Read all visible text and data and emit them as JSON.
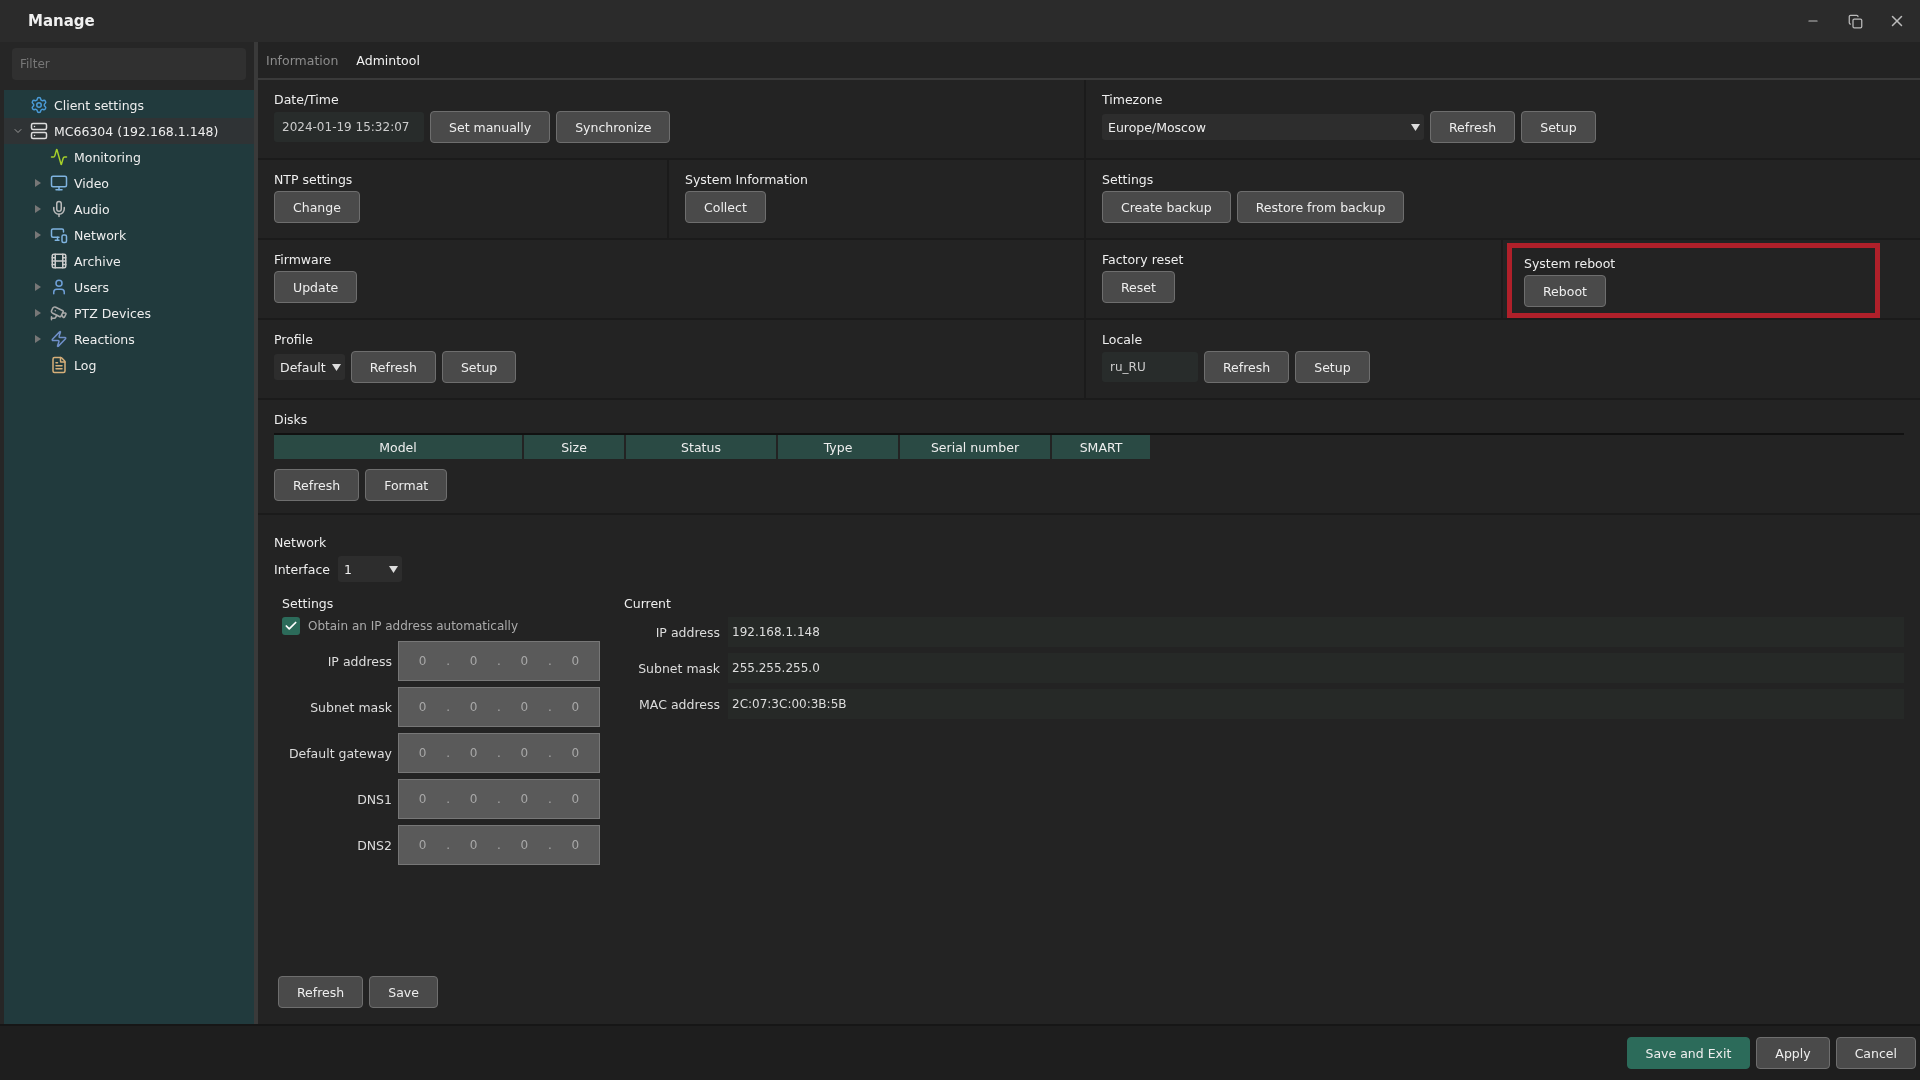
{
  "window": {
    "title": "Manage"
  },
  "sidebar": {
    "filter": {
      "placeholder": "Filter"
    },
    "tree": [
      {
        "label": "Client settings",
        "kind": "settings",
        "selected": false
      },
      {
        "label": "MC66304 (192.168.1.148)",
        "kind": "device",
        "expanded": true,
        "selected": true,
        "children": [
          {
            "label": "Monitoring",
            "kind": "monitoring",
            "selected": false
          },
          {
            "label": "Video",
            "kind": "video",
            "expanded": false,
            "selected": false
          },
          {
            "label": "Audio",
            "kind": "audio",
            "expanded": false,
            "selected": false
          },
          {
            "label": "Network",
            "kind": "network",
            "expanded": false,
            "selected": false
          },
          {
            "label": "Archive",
            "kind": "archive",
            "selected": false
          },
          {
            "label": "Users",
            "kind": "users",
            "expanded": false,
            "selected": false
          },
          {
            "label": "PTZ Devices",
            "kind": "ptz",
            "expanded": false,
            "selected": false
          },
          {
            "label": "Reactions",
            "kind": "reactions",
            "expanded": false,
            "selected": false
          },
          {
            "label": "Log",
            "kind": "log",
            "selected": false
          }
        ]
      }
    ]
  },
  "tabs": [
    {
      "label": "Information",
      "selected": false
    },
    {
      "label": "Admintool",
      "selected": true
    }
  ],
  "sections": [
    [
      {
        "title": "Date/Time",
        "highlighted": false,
        "controls": [
          {
            "kind": "field",
            "text": "2024-01-19 15:32:07"
          },
          {
            "kind": "button",
            "text": "Set manually"
          },
          {
            "kind": "button",
            "text": "Synchronize"
          }
        ]
      },
      {
        "title": "Timezone",
        "highlighted": false,
        "controls": [
          {
            "kind": "select",
            "text": "Europe/Moscow"
          },
          {
            "kind": "button",
            "text": "Refresh"
          },
          {
            "kind": "button",
            "text": "Setup"
          }
        ]
      }
    ],
    [
      {
        "title": "NTP settings",
        "highlighted": false,
        "controls": [
          {
            "kind": "button",
            "text": "Change"
          }
        ]
      },
      {
        "title": "System Information",
        "highlighted": false,
        "controls": [
          {
            "kind": "button",
            "text": "Collect"
          }
        ]
      },
      {
        "title": "Settings",
        "highlighted": false,
        "controls": [
          {
            "kind": "button",
            "text": "Create backup"
          },
          {
            "kind": "button",
            "text": "Restore from backup"
          }
        ]
      }
    ],
    [
      {
        "title": "Firmware",
        "highlighted": false,
        "controls": [
          {
            "kind": "button",
            "text": "Update"
          }
        ]
      },
      {
        "title": "Factory reset",
        "highlighted": false,
        "controls": [
          {
            "kind": "button",
            "text": "Reset"
          }
        ]
      },
      {
        "title": "System reboot",
        "highlighted": true,
        "controls": [
          {
            "kind": "button",
            "text": "Reboot"
          }
        ]
      }
    ],
    [
      {
        "title": "Profile",
        "highlighted": false,
        "controls": [
          {
            "kind": "select",
            "text": "Default"
          },
          {
            "kind": "button",
            "text": "Refresh"
          },
          {
            "kind": "button",
            "text": "Setup"
          }
        ]
      },
      {
        "title": "Locale",
        "highlighted": false,
        "controls": [
          {
            "kind": "field",
            "text": "ru_RU"
          },
          {
            "kind": "button",
            "text": "Refresh"
          },
          {
            "kind": "button",
            "text": "Setup"
          }
        ]
      }
    ]
  ],
  "disks": {
    "title": "Disks",
    "columns": [
      "Model",
      "Size",
      "Status",
      "Type",
      "Serial number",
      "SMART"
    ],
    "buttons": [
      "Refresh",
      "Format"
    ]
  },
  "network": {
    "title": "Network",
    "interface": {
      "label": "Interface",
      "value": "1"
    },
    "settings": {
      "title": "Settings",
      "auto_ip": {
        "label": "Obtain an IP address automatically",
        "checked": true
      },
      "fields": [
        {
          "label": "IP address",
          "octets": [
            "0",
            "0",
            "0",
            "0"
          ]
        },
        {
          "label": "Subnet mask",
          "octets": [
            "0",
            "0",
            "0",
            "0"
          ]
        },
        {
          "label": "Default gateway",
          "octets": [
            "0",
            "0",
            "0",
            "0"
          ]
        },
        {
          "label": "DNS1",
          "octets": [
            "0",
            "0",
            "0",
            "0"
          ]
        },
        {
          "label": "DNS2",
          "octets": [
            "0",
            "0",
            "0",
            "0"
          ]
        }
      ],
      "separator": "."
    },
    "current": {
      "title": "Current",
      "rows": [
        {
          "label": "IP address",
          "value": "192.168.1.148"
        },
        {
          "label": "Subnet mask",
          "value": "255.255.255.0"
        },
        {
          "label": "MAC address",
          "value": "2C:07:3C:00:3B:5B"
        }
      ]
    },
    "buttons": [
      "Refresh",
      "Save"
    ]
  },
  "footer": {
    "buttons": [
      {
        "text": "Save and Exit",
        "kind": "primary"
      },
      {
        "text": "Apply",
        "kind": "default"
      },
      {
        "text": "Cancel",
        "kind": "default"
      }
    ]
  }
}
